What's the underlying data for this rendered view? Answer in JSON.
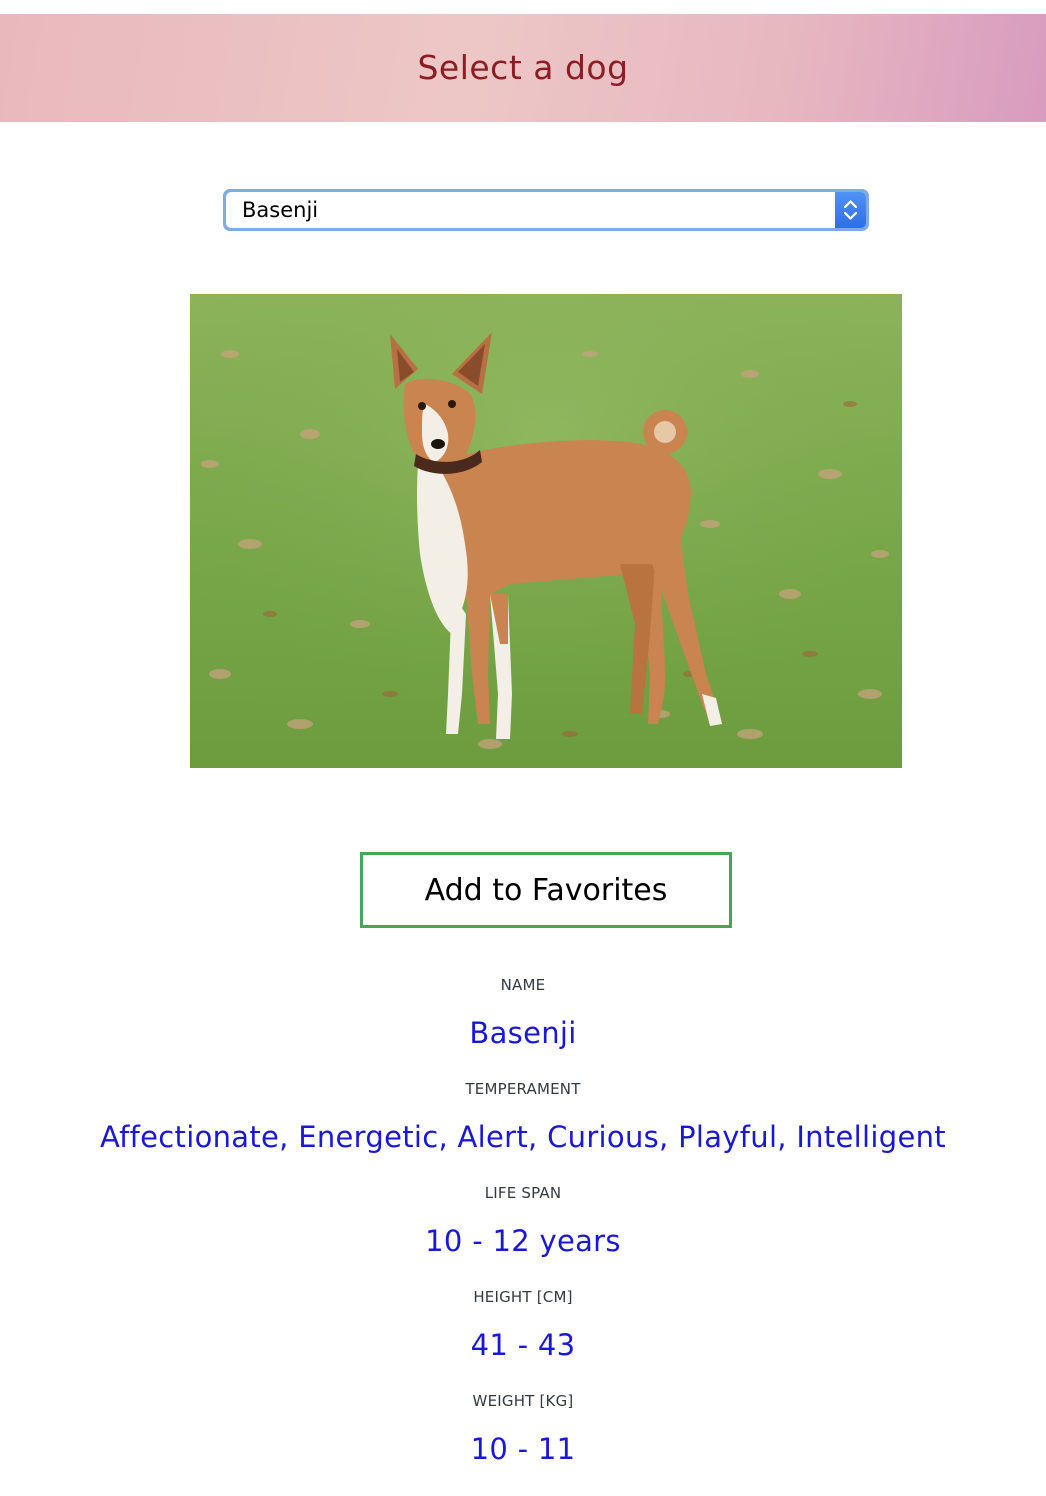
{
  "header": {
    "title": "Select a dog",
    "gradient_colors": [
      "#e9b8bd",
      "#edc7c6",
      "#d89bbf"
    ],
    "title_color": "#8b1d24"
  },
  "breed_select": {
    "selected": "Basenji",
    "icon": "select-stepper-icon",
    "accent_color": "#2d6fe6"
  },
  "photo": {
    "subject": "Basenji dog standing on grass with fallen leaves"
  },
  "favorites_button": {
    "label": "Add to Favorites",
    "border_color": "#46a55a"
  },
  "details": {
    "value_color": "#1a17d8",
    "name": {
      "label": "NAME",
      "value": "Basenji"
    },
    "temperament": {
      "label": "TEMPERAMENT",
      "value": "Affectionate, Energetic, Alert, Curious, Playful, Intelligent"
    },
    "life_span": {
      "label": "LIFE SPAN",
      "value": "10 - 12 years"
    },
    "height": {
      "label": "HEIGHT [CM]",
      "value": "41 - 43"
    },
    "weight": {
      "label": "WEIGHT [KG]",
      "value": "10 - 11"
    }
  }
}
